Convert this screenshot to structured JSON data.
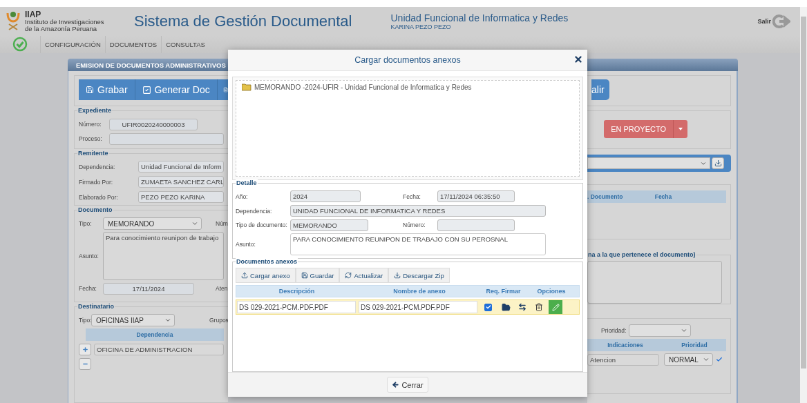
{
  "header": {
    "org_short": "IIAP",
    "org_line_1": "Instituto de Investigaciones",
    "org_line_2": "de la Amazonía Peruana",
    "title": "Sistema de Gestión Documental",
    "unit": "Unidad Funcional de Informatica y Redes",
    "user": "KARINA PEZO PEZO",
    "logout": "Salir"
  },
  "nav": [
    {
      "label": "CONFIGURACIÓN"
    },
    {
      "label": "DOCUMENTOS"
    },
    {
      "label": "CONSULTAS"
    }
  ],
  "panel": {
    "title": "EMISION DE DOCUMENTOS ADMINISTRATIVOS",
    "toolbar": {
      "buttons": [
        {
          "label": "Grabar"
        },
        {
          "label": "Generar Doc"
        }
      ],
      "cut_button": "alir"
    },
    "expediente": {
      "legend": "Expediente",
      "numero_label": "Número:",
      "numero": "UFIR0020240000003",
      "proceso_label": "Proceso:",
      "status": "EN PROYECTO"
    },
    "remitente": {
      "legend": "Remitente",
      "fields": [
        {
          "label": "Dependencia:",
          "value": "Unidad Funcional de Inform"
        },
        {
          "label": "Firmado Por:",
          "value": "ZUMAETA SANCHEZ CARL"
        },
        {
          "label": "Elaborado Por:",
          "value": "PEZO PEZO KARINA"
        }
      ]
    },
    "references": {
      "columns": [
        ". Documento",
        "Fecha"
      ]
    },
    "documento": {
      "legend": "Documento",
      "tipo_label": "Tipo:",
      "tipo": "MEMORANDO",
      "numero_label": "Núm",
      "asunto_label": "Asunto:",
      "asunto": "Para conocimiento reunipon de trabajo",
      "fecha_label": "Fecha:",
      "fecha": "17/11/2024",
      "aten_label": "Aten",
      "observ_legend": "na a la que pertenece el documento)"
    },
    "destinatario": {
      "legend": "Destinatario",
      "tipo_label": "Tipo:",
      "tipo": "OFICINAS IIAP",
      "grupos_label": "Grupos",
      "prioridad_label": "Prioridad:",
      "columns": [
        "Dependencia",
        "Indicaciones",
        "Prioridad"
      ],
      "rows": [
        {
          "dependencia": "OFICINA DE ADMINISTRACION",
          "indicaciones": "Atencion",
          "prioridad": "NORMAL",
          "confirmed": true
        }
      ]
    }
  },
  "modal": {
    "title": "Cargar documentos anexos",
    "tree": [
      {
        "label": "MEMORANDO -2024-UFIR - Unidad Funcional de Informatica y Redes"
      }
    ],
    "detalle": {
      "legend": "Detalle",
      "anio_label": "Año:",
      "anio": "2024",
      "fecha_label": "Fecha:",
      "fecha": "17/11/2024 06:35:50",
      "dependencia_label": "Dependencia:",
      "dependencia": "UNIDAD FUNCIONAL DE INFORMATICA Y REDES",
      "tipo_label": "Tipo de documento:",
      "tipo": "MEMORANDO",
      "numero_label": "Número:",
      "asunto_label": "Asunto:",
      "asunto": "PARA CONOCIMIENTO REUNIPON DE TRABAJO CON SU PEROSNAL"
    },
    "anexos": {
      "legend": "Documentos anexos",
      "actions": [
        {
          "label": "Cargar anexo"
        },
        {
          "label": "Guardar"
        },
        {
          "label": "Actualizar"
        },
        {
          "label": "Descargar Zip"
        }
      ],
      "columns": [
        "Descripción",
        "Nombre de anexo",
        "Req. Firmar",
        "Opciones"
      ],
      "rows": [
        {
          "descripcion": "DS 029-2021-PCM.PDF.PDF",
          "nombre": "DS 029-2021-PCM.PDF.PDF",
          "req_firmar": true
        }
      ]
    },
    "close_button": "Cerrar"
  }
}
